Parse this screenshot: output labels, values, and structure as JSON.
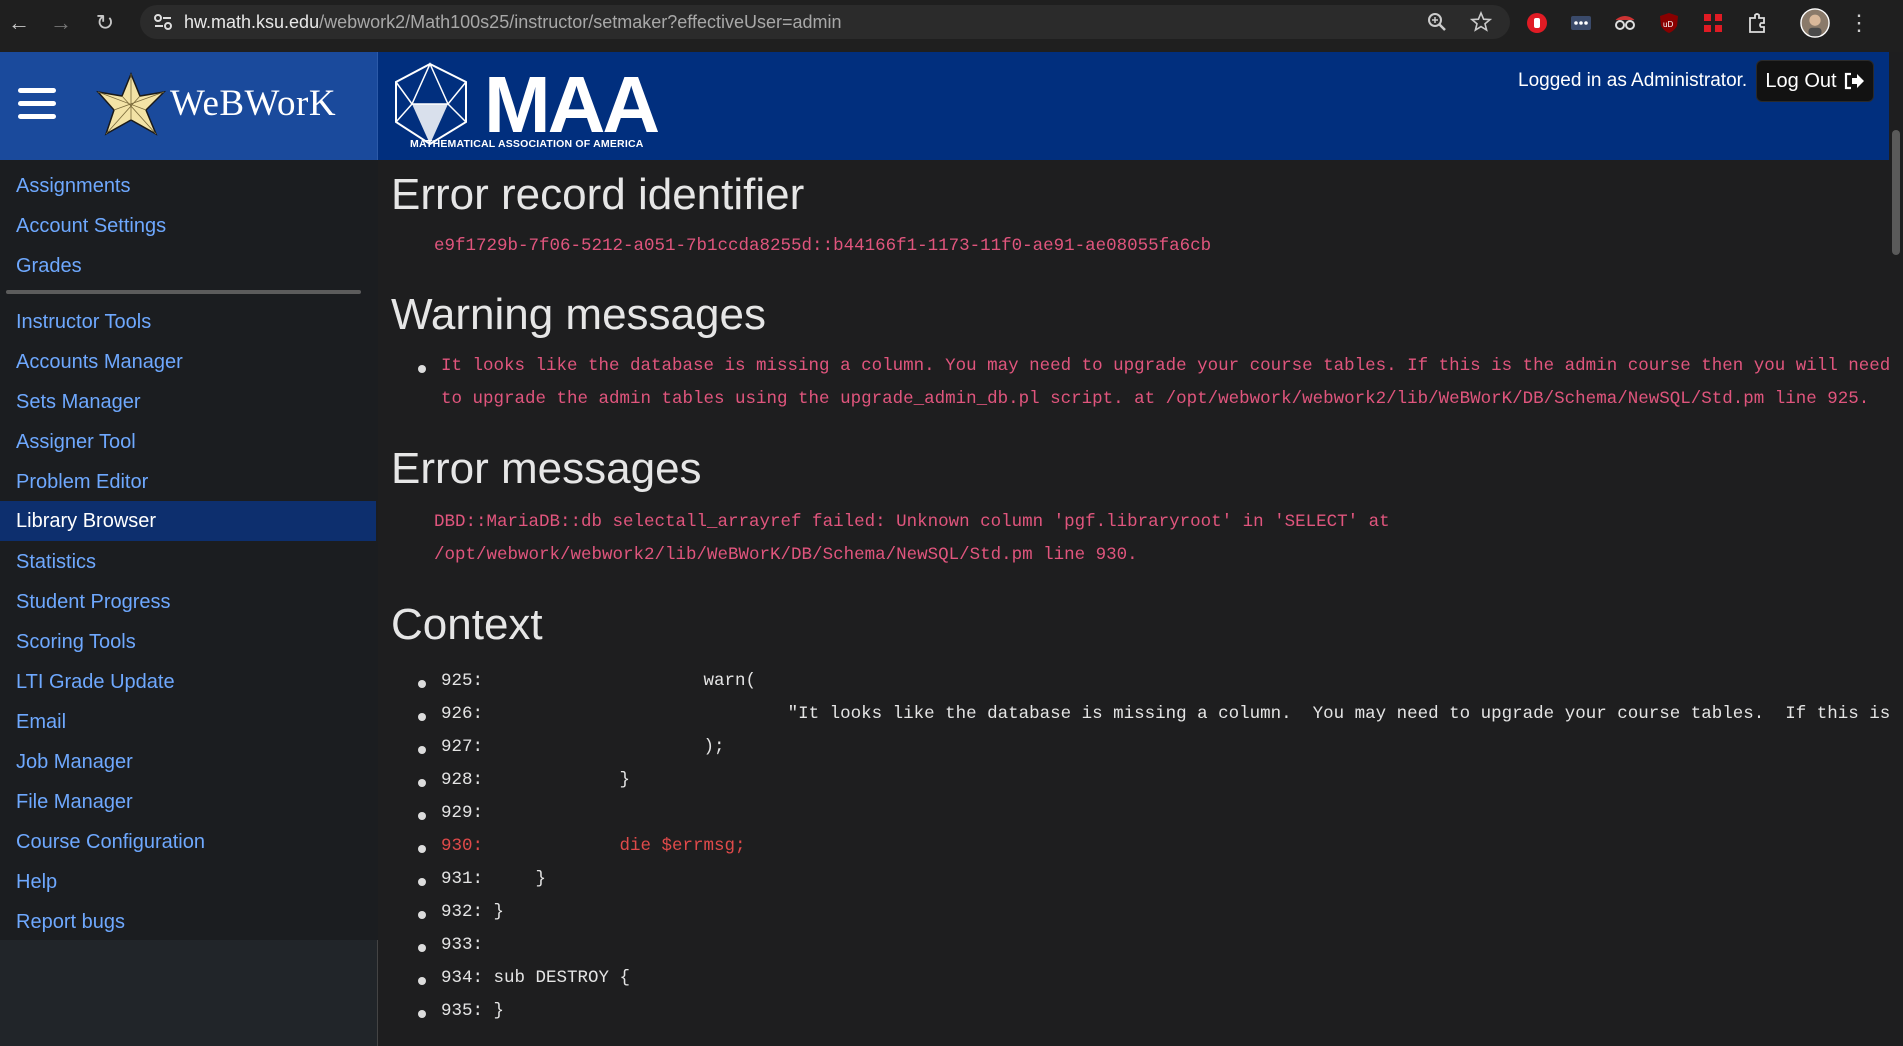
{
  "browser": {
    "url_host": "hw.math.ksu.edu",
    "url_path": "/webwork2/Math100s25/instructor/setmaker?effectiveUser=admin"
  },
  "header": {
    "webwork_logo_text": "WeBWorK",
    "maa_logo_text": "MAA",
    "maa_subtitle": "MATHEMATICAL ASSOCIATION OF AMERICA",
    "logged_in_text": "Logged in as Administrator.",
    "logout_label": "Log Out"
  },
  "sidebar": {
    "items": [
      {
        "label": "Assignments"
      },
      {
        "label": "Account Settings"
      },
      {
        "label": "Grades"
      },
      {
        "label": "Instructor Tools"
      },
      {
        "label": "Accounts Manager"
      },
      {
        "label": "Sets Manager"
      },
      {
        "label": "Assigner Tool"
      },
      {
        "label": "Problem Editor"
      },
      {
        "label": "Library Browser"
      },
      {
        "label": "Statistics"
      },
      {
        "label": "Student Progress"
      },
      {
        "label": "Scoring Tools"
      },
      {
        "label": "LTI Grade Update"
      },
      {
        "label": "Email"
      },
      {
        "label": "Job Manager"
      },
      {
        "label": "File Manager"
      },
      {
        "label": "Course Configuration"
      },
      {
        "label": "Help"
      },
      {
        "label": "Report bugs"
      }
    ],
    "active_item": "Library Browser"
  },
  "main": {
    "error_id_heading": "Error record identifier",
    "error_id": "e9f1729b-7f06-5212-a051-7b1ccda8255d::b44166f1-1173-11f0-ae91-ae08055fa6cb",
    "warnings_heading": "Warning messages",
    "warning_line1": "It looks like the database is missing a column. You may need to upgrade your course tables. If this is the admin course then you will need",
    "warning_line2": "to upgrade the admin tables using the upgrade_admin_db.pl script. at /opt/webwork/webwork2/lib/WeBWorK/DB/Schema/NewSQL/Std.pm line 925.",
    "errors_heading": "Error messages",
    "error_line1": "DBD::MariaDB::db selectall_arrayref failed: Unknown column 'pgf.libraryroot' in 'SELECT' at",
    "error_line2": "/opt/webwork/webwork2/lib/WeBWorK/DB/Schema/NewSQL/Std.pm line 930.",
    "context_heading": "Context",
    "context": [
      {
        "num": "925:",
        "code": "                    warn("
      },
      {
        "num": "926:",
        "code": "                            \"It looks like the database is missing a column.  You may need to upgrade your course tables.  If this is the"
      },
      {
        "num": "927:",
        "code": "                    );"
      },
      {
        "num": "928:",
        "code": "            }"
      },
      {
        "num": "929:",
        "code": ""
      },
      {
        "num": "930:",
        "code": "            die $errmsg;"
      },
      {
        "num": "931:",
        "code": "    }"
      },
      {
        "num": "932:",
        "code": "}"
      },
      {
        "num": "933:",
        "code": ""
      },
      {
        "num": "934:",
        "code": "sub DESTROY {"
      },
      {
        "num": "935:",
        "code": "}"
      }
    ],
    "highlight_index": 5
  }
}
